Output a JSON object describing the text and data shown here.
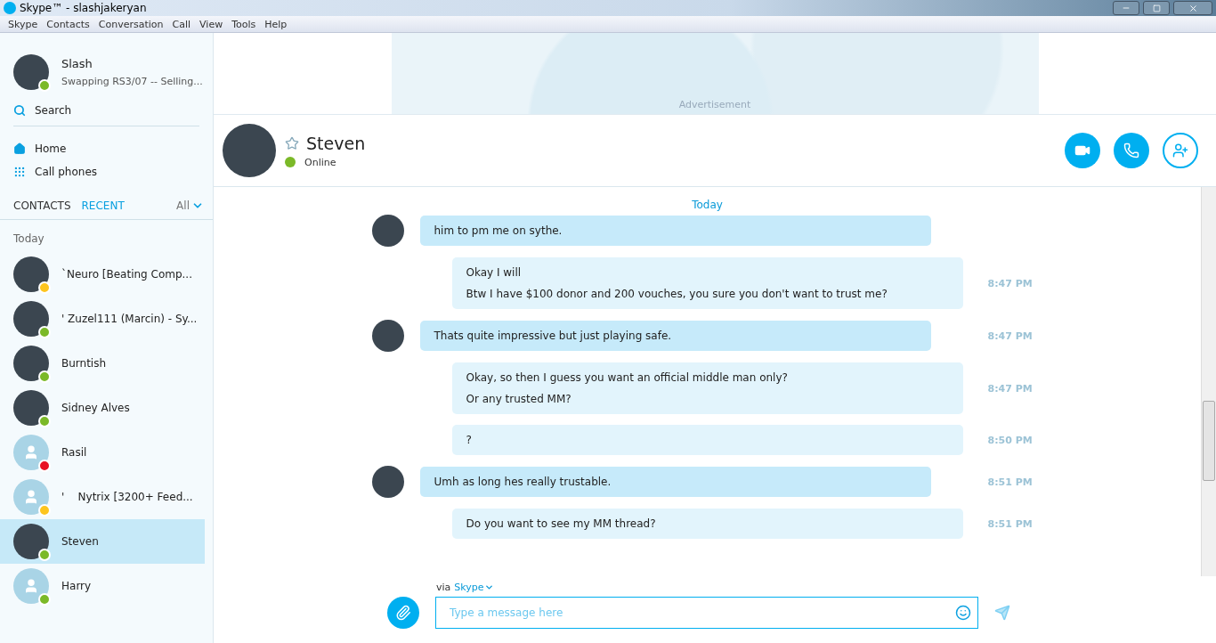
{
  "window": {
    "title": "Skype™ - slashjakeryan"
  },
  "menu": [
    "Skype",
    "Contacts",
    "Conversation",
    "Call",
    "View",
    "Tools",
    "Help"
  ],
  "profile": {
    "name": "Slash",
    "mood": "Swapping RS3/07 -- Selling...",
    "color": "#7bb928"
  },
  "search": {
    "label": "Search"
  },
  "nav": [
    "Home",
    "Call phones"
  ],
  "list_tabs": [
    {
      "label": "CONTACTS",
      "selected": false
    },
    {
      "label": "RECENT",
      "selected": true
    }
  ],
  "filter": "All",
  "section": "Today",
  "contacts": [
    {
      "name": "`Neuro [Beating Comp...",
      "color": "#fdc51f",
      "kind": "photo",
      "selected": false
    },
    {
      "name": "' Zuzel111 (Marcin) - Sy...",
      "color": "#7bb928",
      "kind": "photo",
      "selected": false
    },
    {
      "name": "Burntish",
      "color": "#7bb928",
      "kind": "photo",
      "selected": false
    },
    {
      "name": "Sidney Alves",
      "color": "#7bb928",
      "kind": "photo",
      "selected": false
    },
    {
      "name": "Rasil",
      "color": "#e81123",
      "kind": "default",
      "selected": false
    },
    {
      "name": "'    Nytrix [3200+ Feed...",
      "color": "#fdc51f",
      "kind": "default",
      "selected": false
    },
    {
      "name": "Steven",
      "color": "#7bb928",
      "kind": "photo",
      "selected": true
    },
    {
      "name": "Harry",
      "color": "#7bb928",
      "kind": "default",
      "selected": false
    }
  ],
  "ad": {
    "label": "Advertisement"
  },
  "conversation": {
    "name": "Steven",
    "color": "#7bb928",
    "status_text": "Online",
    "favorite": false
  },
  "day": "Today",
  "messages": [
    {
      "kind": "them",
      "lines": [
        "him to pm me on sythe."
      ]
    },
    {
      "kind": "me",
      "lines": [
        "Okay I will",
        "Btw I have $100 donor and 200 vouches, you sure you don't want to trust me?"
      ],
      "time": "8:47 PM"
    },
    {
      "kind": "them",
      "lines": [
        "Thats quite impressive but just playing safe."
      ],
      "time": "8:47 PM"
    },
    {
      "kind": "me",
      "lines": [
        "Okay, so then I guess you want an official middle man only?",
        "Or any trusted MM?"
      ],
      "time": "8:47 PM"
    },
    {
      "kind": "me",
      "lines": [
        "?"
      ],
      "time": "8:50 PM"
    },
    {
      "kind": "them",
      "lines": [
        "Umh as long hes really trustable."
      ],
      "time": "8:51 PM"
    },
    {
      "kind": "me",
      "lines": [
        "Do you want to see my MM thread?"
      ],
      "time": "8:51 PM"
    }
  ],
  "composer": {
    "via": "via",
    "service": "Skype",
    "placeholder": "Type a message here"
  }
}
